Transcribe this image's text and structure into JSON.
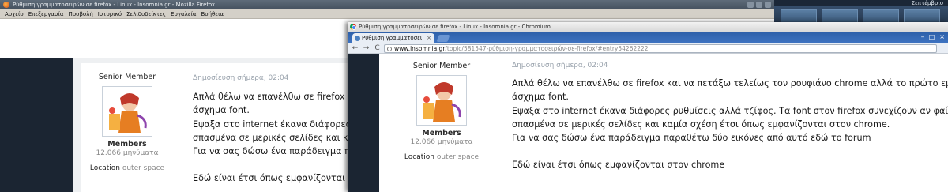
{
  "firefox": {
    "title": "Ρύθμιση γραμματοσειρών σε firefox - Linux - Insomnia.gr - Mozilla Firefox",
    "menu": [
      "Αρχείο",
      "Επεξεργασία",
      "Προβολή",
      "Ιστορικό",
      "Σελιδοδείκτες",
      "Εργαλεία",
      "Βοήθεια"
    ],
    "post": {
      "rank": "Senior Member",
      "group": "Members",
      "posts": "12.066 μηνύματα",
      "location_label": "Location",
      "location_value": "outer space",
      "date": "Δημοσίευση σήμερα, 02:04",
      "lines": [
        "Απλά θέλω να επανέλθω σε firefox και ν",
        "άσχημα font.",
        "Εψαξα στο internet έκανα διάφορες ρυθ",
        "σπασμένα σε μερικές σελίδες και καμία",
        "Για να σας δώσω ένα παράδειγμα παρα",
        "",
        "Εδώ είναι έτσι όπως εμφανίζονται στον"
      ]
    }
  },
  "desktop": {
    "clock": "Σεπτέμβριο"
  },
  "chromium": {
    "title": "Ρύθμιση γραμματοσειρών σε firefox - Linux - Insomnia.gr - Chromium",
    "tab_label": "Ρύθμιση γραμματοσει",
    "tab_close": "×",
    "nav": {
      "back": "←",
      "forward": "→",
      "reload": "C"
    },
    "url_host": "www.insomnia.gr",
    "url_path": "/topic/581547-ρύθμιση-γραμματοσειρών-σε-firefox/#entry54262222",
    "post": {
      "rank": "Senior Member",
      "group": "Members",
      "posts": "12.066 μηνύματα",
      "location_label": "Location",
      "location_value": "outer space",
      "date": "Δημοσίευση σήμερα, 02:04",
      "lines": [
        "Απλά θέλω να επανέλθω σε firefox και να πετάξω τελείως τον ρουφιάνο chrome αλλά το πρώτο εμπόδιο που",
        "άσχημα font.",
        "Εψαξα στο internet έκανα διάφορες ρυθμίσεις αλλά τζίφος. Τα font στον firefox συνεχίζουν αν φαίνονται πού",
        "σπασμένα σε μερικές σελίδες και καμία σχέση έτσι όπως εμφανίζονται στον chrome.",
        "Για να σας δώσω ένα παράδειγμα παραθέτω δύο εικόνες από αυτό εδώ το forum",
        "",
        "Εδώ είναι έτσι όπως εμφανίζονται στον chrome"
      ]
    }
  }
}
